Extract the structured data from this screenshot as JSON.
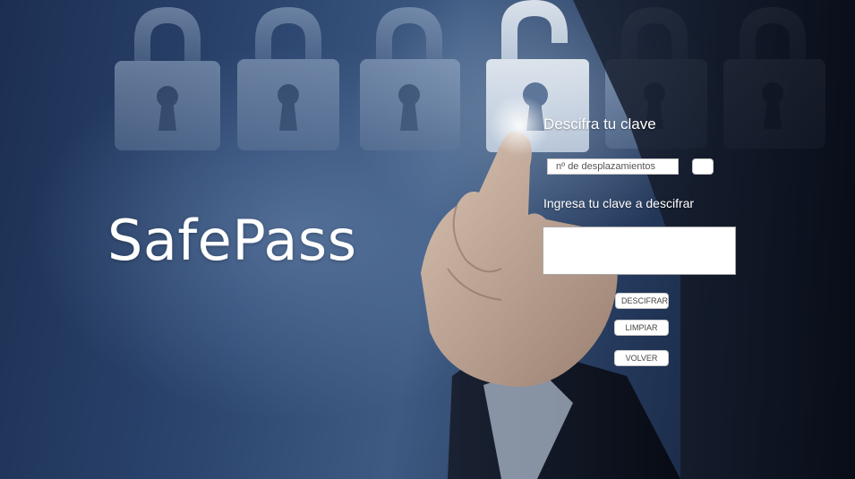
{
  "brand": {
    "name": "SafePass"
  },
  "form": {
    "title": "Descifra tu clave",
    "shift_input": {
      "placeholder": "nº de desplazamientos",
      "value": ""
    },
    "cipher_label": "Ingresa tu clave a descifrar",
    "cipher_text": {
      "value": ""
    },
    "buttons": {
      "decrypt": "DESCIFRAR",
      "clear": "LIMPIAR",
      "back": "VOLVER"
    }
  },
  "background": {
    "icons": [
      "lock-icon",
      "lock-icon",
      "lock-icon",
      "unlocked-lock-icon",
      "lock-icon",
      "lock-icon"
    ],
    "colors": {
      "dark_navy": "#0d1628",
      "mid_blue": "#3e5a82",
      "text": "#ffffff"
    }
  }
}
